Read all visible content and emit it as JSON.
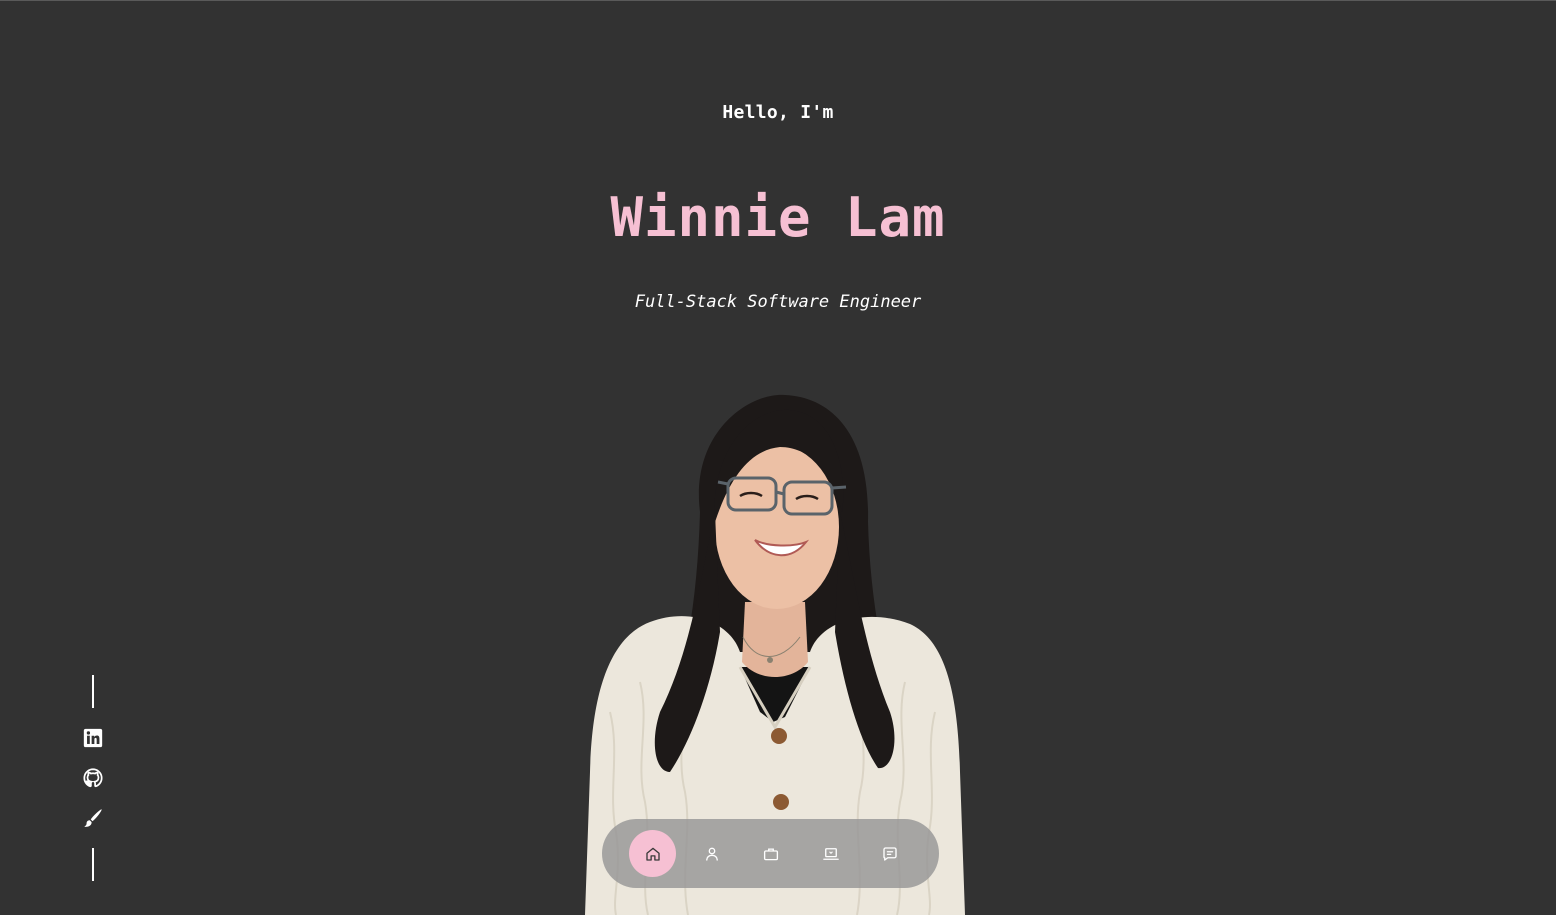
{
  "hero": {
    "greeting": "Hello, I'm",
    "name": "Winnie Lam",
    "role": "Full-Stack Software Engineer"
  },
  "colors": {
    "background": "#323232",
    "accent_pink": "#f6c0d3",
    "text": "#ffffff",
    "dock": "#969696"
  },
  "social": {
    "items": [
      {
        "icon": "linkedin-icon",
        "label": "LinkedIn"
      },
      {
        "icon": "github-icon",
        "label": "GitHub"
      },
      {
        "icon": "brush-icon",
        "label": "Design"
      }
    ]
  },
  "nav": {
    "active": "home",
    "items": [
      {
        "icon": "home-icon",
        "label": "Home"
      },
      {
        "icon": "user-icon",
        "label": "About"
      },
      {
        "icon": "briefcase-icon",
        "label": "Experience"
      },
      {
        "icon": "laptop-icon",
        "label": "Projects"
      },
      {
        "icon": "message-icon",
        "label": "Contact"
      }
    ]
  }
}
